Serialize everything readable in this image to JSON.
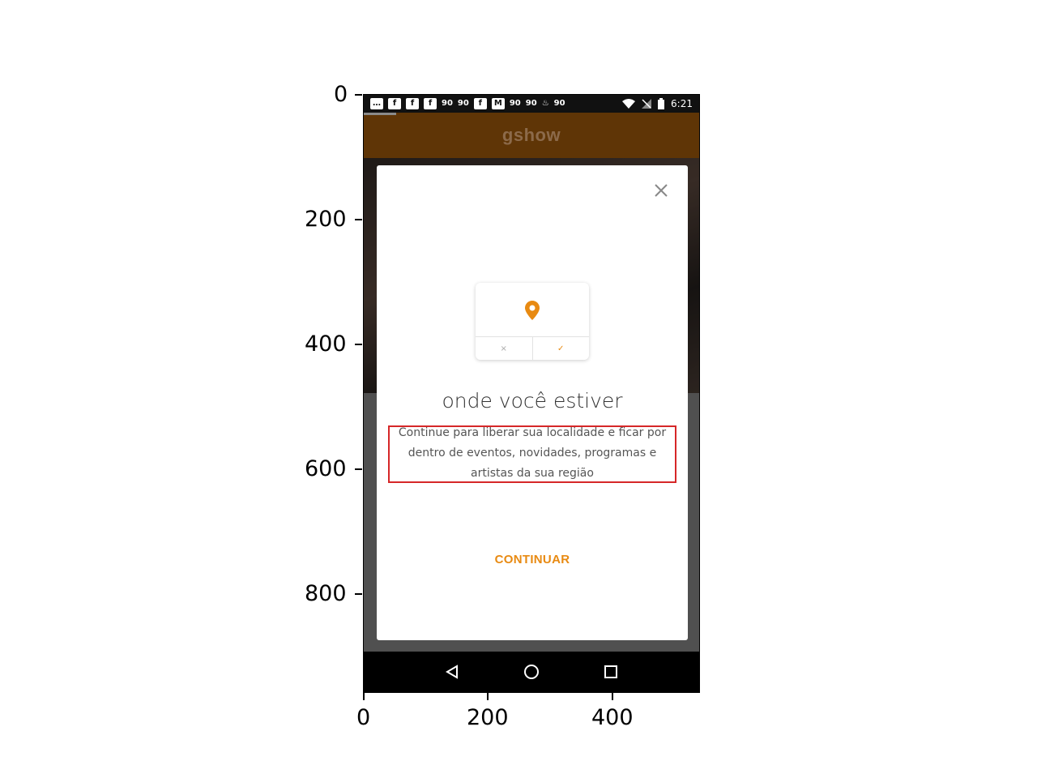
{
  "status_bar": {
    "time": "6:21",
    "notification_icons": [
      "message-icon",
      "facebook-icon",
      "facebook-icon",
      "facebook-icon",
      "gp-icon",
      "gp-icon",
      "facebook-icon",
      "gmail-icon",
      "gp-icon",
      "gp-icon",
      "fire-icon",
      "gp-icon"
    ],
    "gp_label": "90"
  },
  "app_bar": {
    "logo": "gshow"
  },
  "modal": {
    "title": "onde você estiver",
    "body": "Continue para liberar sua localidade e ficar por dentro de eventos, novidades, programas e artistas da sua região",
    "continue_label": "CONTINUAR",
    "illustration": {
      "deny_glyph": "×",
      "accept_glyph": "✓"
    }
  },
  "axes": {
    "y_ticks": [
      "0",
      "200",
      "400",
      "600",
      "800"
    ],
    "x_ticks": [
      "0",
      "200",
      "400"
    ]
  },
  "colors": {
    "accent": "#e88a12",
    "app_bar": "#5f3506",
    "highlight": "#d62728"
  }
}
